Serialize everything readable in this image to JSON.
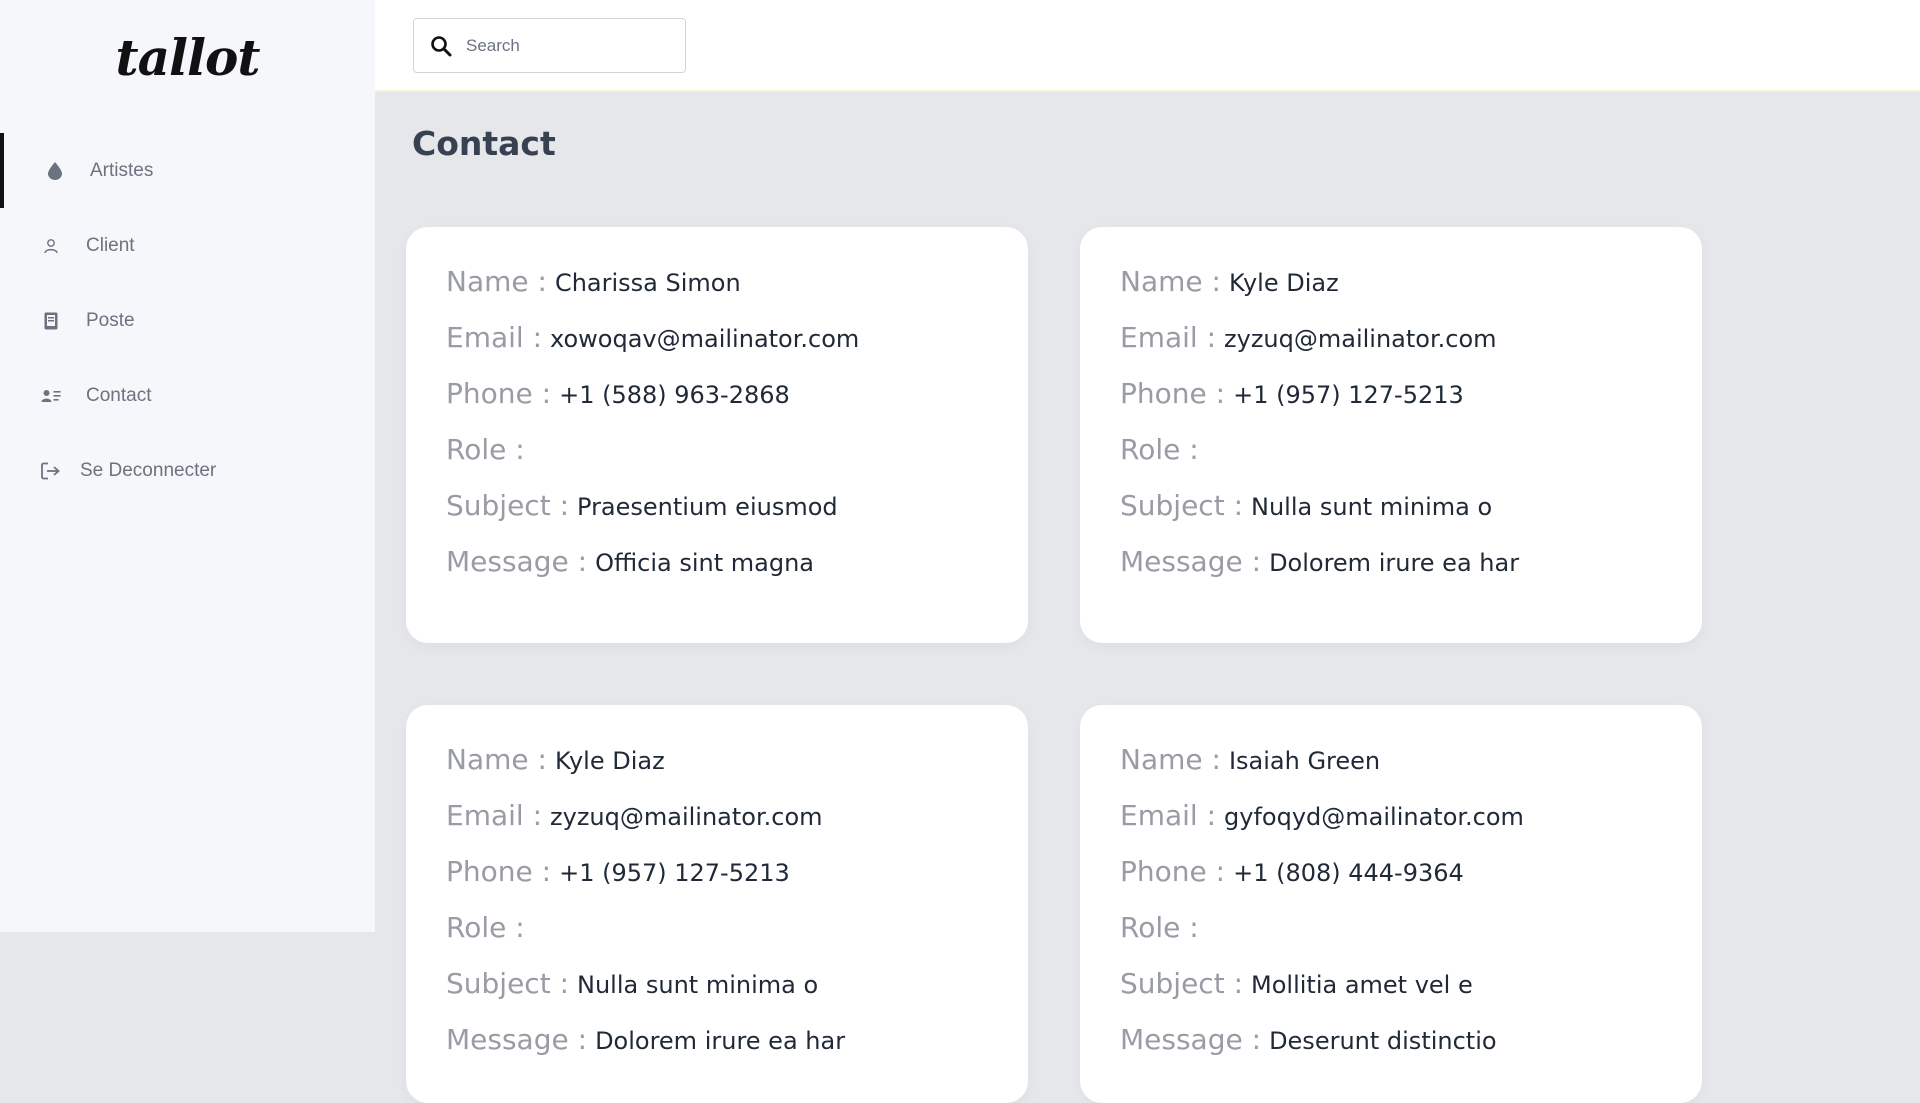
{
  "brand": {
    "logo_text": "tallot"
  },
  "sidebar": {
    "items": [
      {
        "label": "Artistes",
        "icon": "drop-icon",
        "active": true
      },
      {
        "label": "Client",
        "icon": "user-icon",
        "active": false
      },
      {
        "label": "Poste",
        "icon": "document-icon",
        "active": false
      },
      {
        "label": "Contact",
        "icon": "contact-card-icon",
        "active": false
      },
      {
        "label": "Se Deconnecter",
        "icon": "logout-icon",
        "active": false
      }
    ]
  },
  "search": {
    "placeholder": "Search",
    "value": ""
  },
  "page": {
    "title": "Contact"
  },
  "field_labels": {
    "name": "Name :",
    "email": "Email :",
    "phone": "Phone :",
    "role": "Role :",
    "subject": "Subject :",
    "message": "Message :"
  },
  "contacts": [
    {
      "name": "Charissa Simon",
      "email": "xowoqav@mailinator.com",
      "phone": "+1 (588) 963-2868",
      "role": "",
      "subject": "Praesentium eiusmod",
      "message": "Officia sint magna"
    },
    {
      "name": "Kyle Diaz",
      "email": "zyzuq@mailinator.com",
      "phone": "+1 (957) 127-5213",
      "role": "",
      "subject": "Nulla sunt minima o",
      "message": "Dolorem irure ea har"
    },
    {
      "name": "Kyle Diaz",
      "email": "zyzuq@mailinator.com",
      "phone": "+1 (957) 127-5213",
      "role": "",
      "subject": "Nulla sunt minima o",
      "message": "Dolorem irure ea har"
    },
    {
      "name": "Isaiah Green",
      "email": "gyfoqyd@mailinator.com",
      "phone": "+1 (808) 444-9364",
      "role": "",
      "subject": "Mollitia amet vel e",
      "message": "Deserunt distinctio"
    }
  ],
  "colors": {
    "accent": "#111111",
    "label": "#9a9ca5",
    "value": "#1f2937",
    "background": "#e5e7eb"
  }
}
